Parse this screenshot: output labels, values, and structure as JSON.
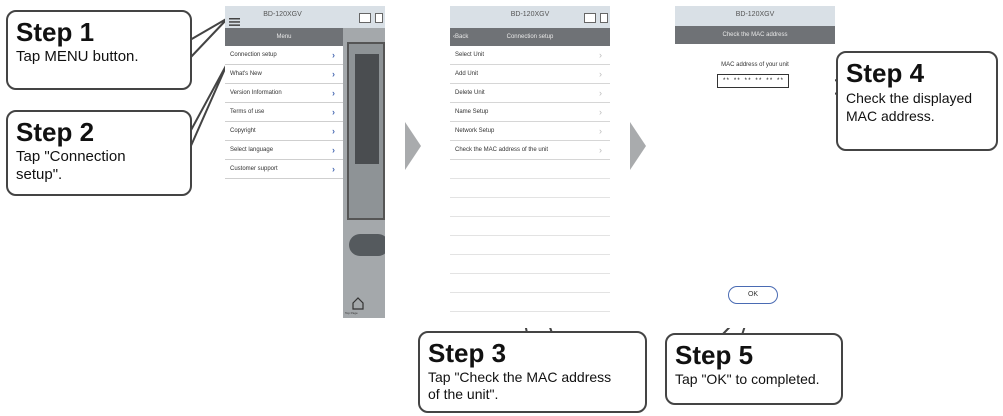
{
  "steps": [
    {
      "title": "Step 1",
      "desc": "Tap MENU button."
    },
    {
      "title": "Step 2",
      "desc": "Tap \"Connection setup\"."
    },
    {
      "title": "Step 3",
      "desc": "Tap \"Check the MAC address of the unit\"."
    },
    {
      "title": "Step 4",
      "desc": "Check the displayed MAC address."
    },
    {
      "title": "Step 5",
      "desc": "Tap \"OK\" to completed."
    }
  ],
  "screen1": {
    "device": "BD-120XGV",
    "menu_title": "Menu",
    "items": [
      "Connection setup",
      "What's New",
      "Version Information",
      "Terms of use",
      "Copyright",
      "Select language",
      "Customer support"
    ],
    "home_label": "Top Page"
  },
  "screen2": {
    "device": "BD-120XGV",
    "back_label": "Back",
    "nav_title": "Connection setup",
    "items": [
      "Select Unit",
      "Add Unit",
      "Delete Unit",
      "Name Setup",
      "Network Setup",
      "Check the MAC address of the unit"
    ]
  },
  "screen3": {
    "device": "BD-120XGV",
    "nav_title": "Check the MAC address",
    "mac_label": "MAC address of your unit",
    "mac_value": "** ** ** ** ** **",
    "ok_label": "OK"
  },
  "colors": {
    "statusbar": "#d9e0e6",
    "navbar": "#6f7276",
    "menu_chevron": "#4a6bb3",
    "arrow": "#a9abad"
  },
  "icons": [
    "menu-icon",
    "screen-mirror-icon",
    "battery-icon",
    "chevron-right-icon",
    "chevron-left-icon",
    "home-icon"
  ]
}
